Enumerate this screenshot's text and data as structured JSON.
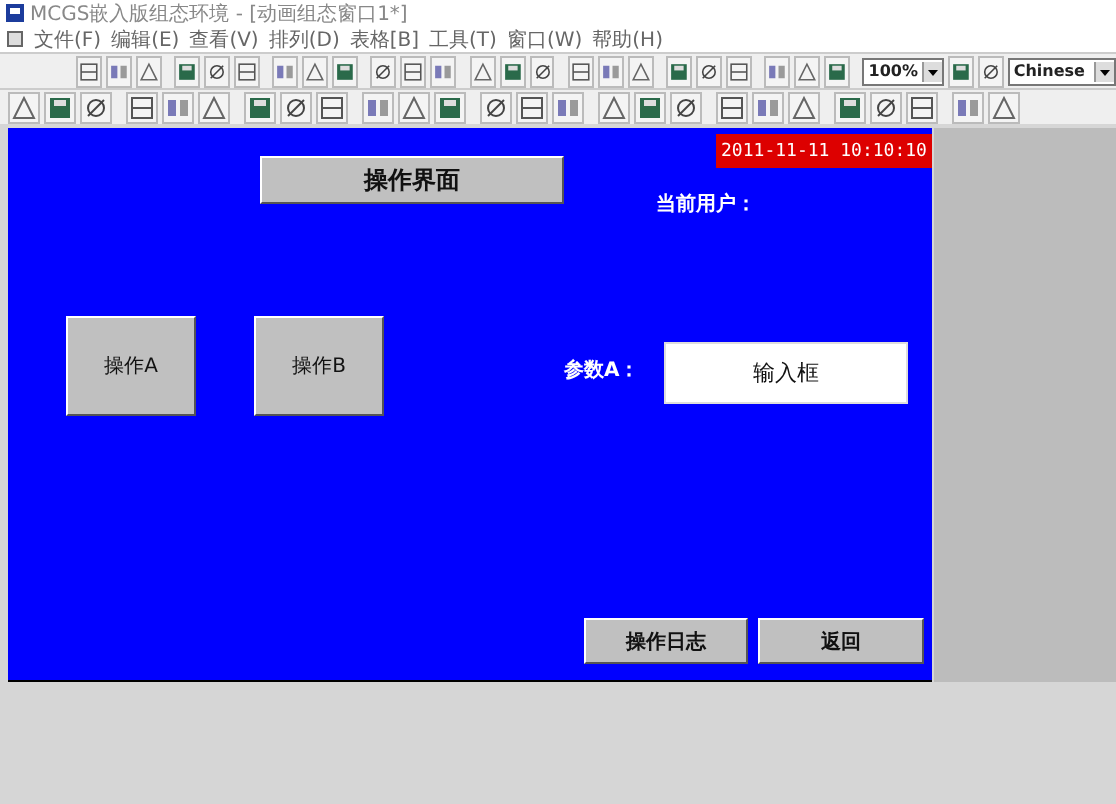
{
  "window": {
    "title": "MCGS嵌入版组态环境 - [动画组态窗口1*]"
  },
  "menu": [
    {
      "label": "文件(F)"
    },
    {
      "label": "编辑(E)"
    },
    {
      "label": "查看(V)"
    },
    {
      "label": "排列(D)"
    },
    {
      "label": "表格[B]"
    },
    {
      "label": "工具(T)"
    },
    {
      "label": "窗口(W)"
    },
    {
      "label": "帮助(H)"
    }
  ],
  "toolbar": {
    "zoom": "100%",
    "language": "Chinese"
  },
  "canvas": {
    "title": "操作界面",
    "datetime": "2011-11-11 10:10:10",
    "user_label": "当前用户：",
    "param_label": "参数A：",
    "input_value": "输入框",
    "buttons": [
      {
        "label": "操作A",
        "kind": "square"
      },
      {
        "label": "操作B",
        "kind": "square"
      },
      {
        "label": "操作日志",
        "kind": "bar"
      },
      {
        "label": "返回",
        "kind": "bar"
      }
    ]
  }
}
